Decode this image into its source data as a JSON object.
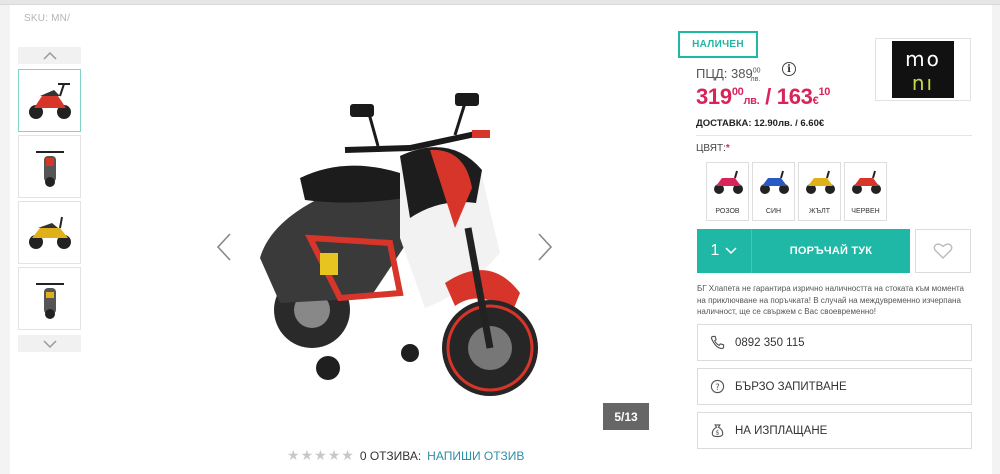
{
  "sku": {
    "label": "SKU:",
    "value": "MN/"
  },
  "gallery": {
    "counter": "5/13",
    "thumbnails": [
      {
        "color": "#d8352a"
      },
      {
        "color": "#555555"
      },
      {
        "color": "#e0b01a"
      },
      {
        "color": "#555555"
      }
    ]
  },
  "reviews": {
    "count_label": "0 ОТЗИВА:",
    "write_link": "НАПИШИ ОТЗИВ",
    "rating": 0,
    "max": 5
  },
  "product": {
    "availability": "НАЛИЧЕН",
    "rrp_label": "ПЦД: 389",
    "rrp_cents": "00",
    "rrp_currency": "лв.",
    "price_bgn": "319",
    "price_bgn_cents": "00",
    "price_bgn_currency": "лв.",
    "price_sep": " / ",
    "price_eur": "163",
    "price_eur_cents": "10",
    "price_eur_currency": "€",
    "delivery": "ДОСТАВКА: 12.90лв. / 6.60€"
  },
  "brand": {
    "logo_text": "MONI"
  },
  "color_option": {
    "label": "ЦВЯТ:",
    "required_mark": "*",
    "options": [
      {
        "label": "РОЗОВ",
        "color": "#d9245b"
      },
      {
        "label": "СИН",
        "color": "#2b59c3"
      },
      {
        "label": "ЖЪЛТ",
        "color": "#e0b01a"
      },
      {
        "label": "ЧЕРВЕН",
        "color": "#d8352a"
      }
    ]
  },
  "cart": {
    "quantity": "1",
    "buy_label": "ПОРЪЧАЙ ТУК"
  },
  "note": "БГ Хлапета не гарантира изрично наличността на стоката към момента на приключване на поръчката! В случай на междувременно изчерпана наличност, ще се свържем с Вас своевременно!",
  "actions": {
    "phone": "0892 350 115",
    "inquiry": "БЪРЗО ЗАПИТВАНЕ",
    "installments": "НА ИЗПЛАЩАНЕ"
  },
  "colors": {
    "accent": "#1fb7a6",
    "price": "#d9245b",
    "link": "#2e8fa8"
  }
}
